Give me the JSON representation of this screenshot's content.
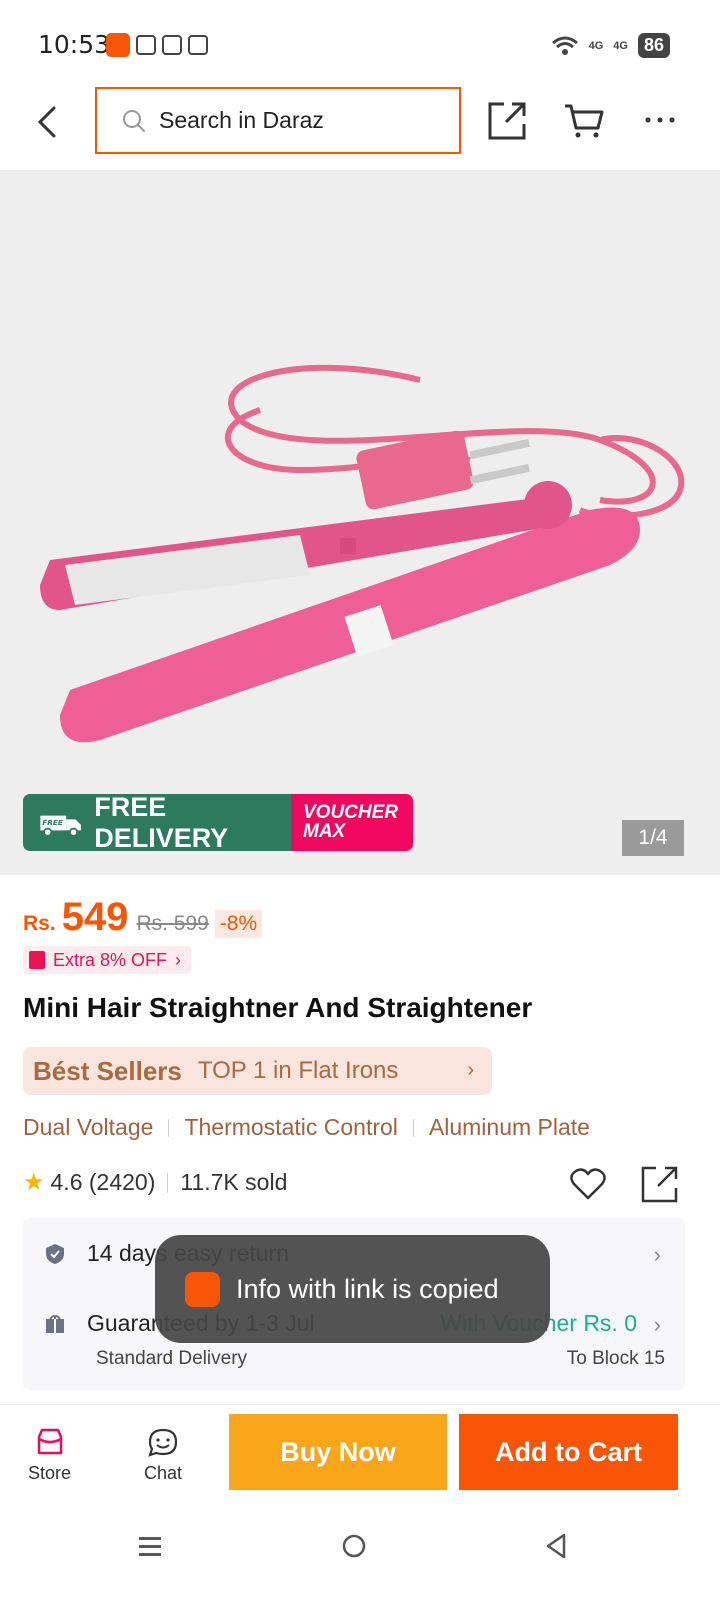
{
  "status_bar": {
    "time": "10:53",
    "network_labels": [
      "4G",
      "4G"
    ],
    "battery": "86"
  },
  "header": {
    "search_placeholder": "Search in Daraz"
  },
  "gallery": {
    "promo_free": "FREE DELIVERY",
    "promo_free_tag": "FREE",
    "promo_voucher_line1": "VOUCHER",
    "promo_voucher_line2": "MAX",
    "counter": "1/4"
  },
  "price": {
    "currency": "Rs.",
    "current": "549",
    "original": "Rs. 599",
    "discount": "-8%",
    "extra_off": "Extra 8% OFF"
  },
  "product": {
    "title": "Mini Hair Straightner And Straightener",
    "bestseller_brand": "Bést Sellers",
    "bestseller_text": "TOP 1 in Flat Irons",
    "features": [
      "Dual Voltage",
      "Thermostatic Control",
      "Aluminum Plate"
    ],
    "rating": "4.6 (2420)",
    "sold": "11.7K sold"
  },
  "info": {
    "return_text": "14 days easy return",
    "guarantee_text": "Guaranteed by 1-3 Jul",
    "voucher_text": "With Voucher Rs. 0",
    "delivery_type": "Standard Delivery",
    "delivery_to": "To Block 15"
  },
  "toast": {
    "text": "Info with link is copied"
  },
  "bottom_bar": {
    "store": "Store",
    "chat": "Chat",
    "buy_now": "Buy Now",
    "add_to_cart": "Add to Cart"
  },
  "colors": {
    "brand_orange": "#f85606",
    "buy_now_yellow": "#faa61a",
    "delivery_green": "#2e7a5e",
    "voucher_pink": "#f0085f",
    "voucher_green": "#18b08a"
  }
}
